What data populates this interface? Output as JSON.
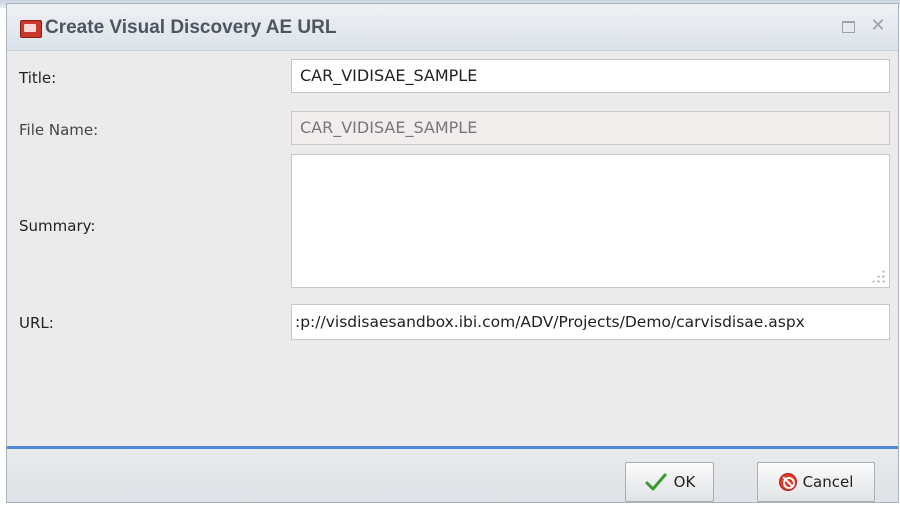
{
  "dialog": {
    "title": "Create Visual Discovery AE URL",
    "app_icon": "report-icon",
    "maximize_icon": "maximize-icon",
    "close_icon": "close-icon"
  },
  "form": {
    "title_label": "Title:",
    "title_value": "CAR_VIDISAE_SAMPLE",
    "filename_label": "File Name:",
    "filename_value": "CAR_VIDISAE_SAMPLE",
    "summary_label": "Summary:",
    "summary_value": "",
    "url_label": "URL:",
    "url_value": ":p://visdisaesandbox.ibi.com/ADV/Projects/Demo/carvisdisae.aspx"
  },
  "footer": {
    "ok_label": "OK",
    "cancel_label": "Cancel",
    "accent_color": "#4f86d6"
  }
}
